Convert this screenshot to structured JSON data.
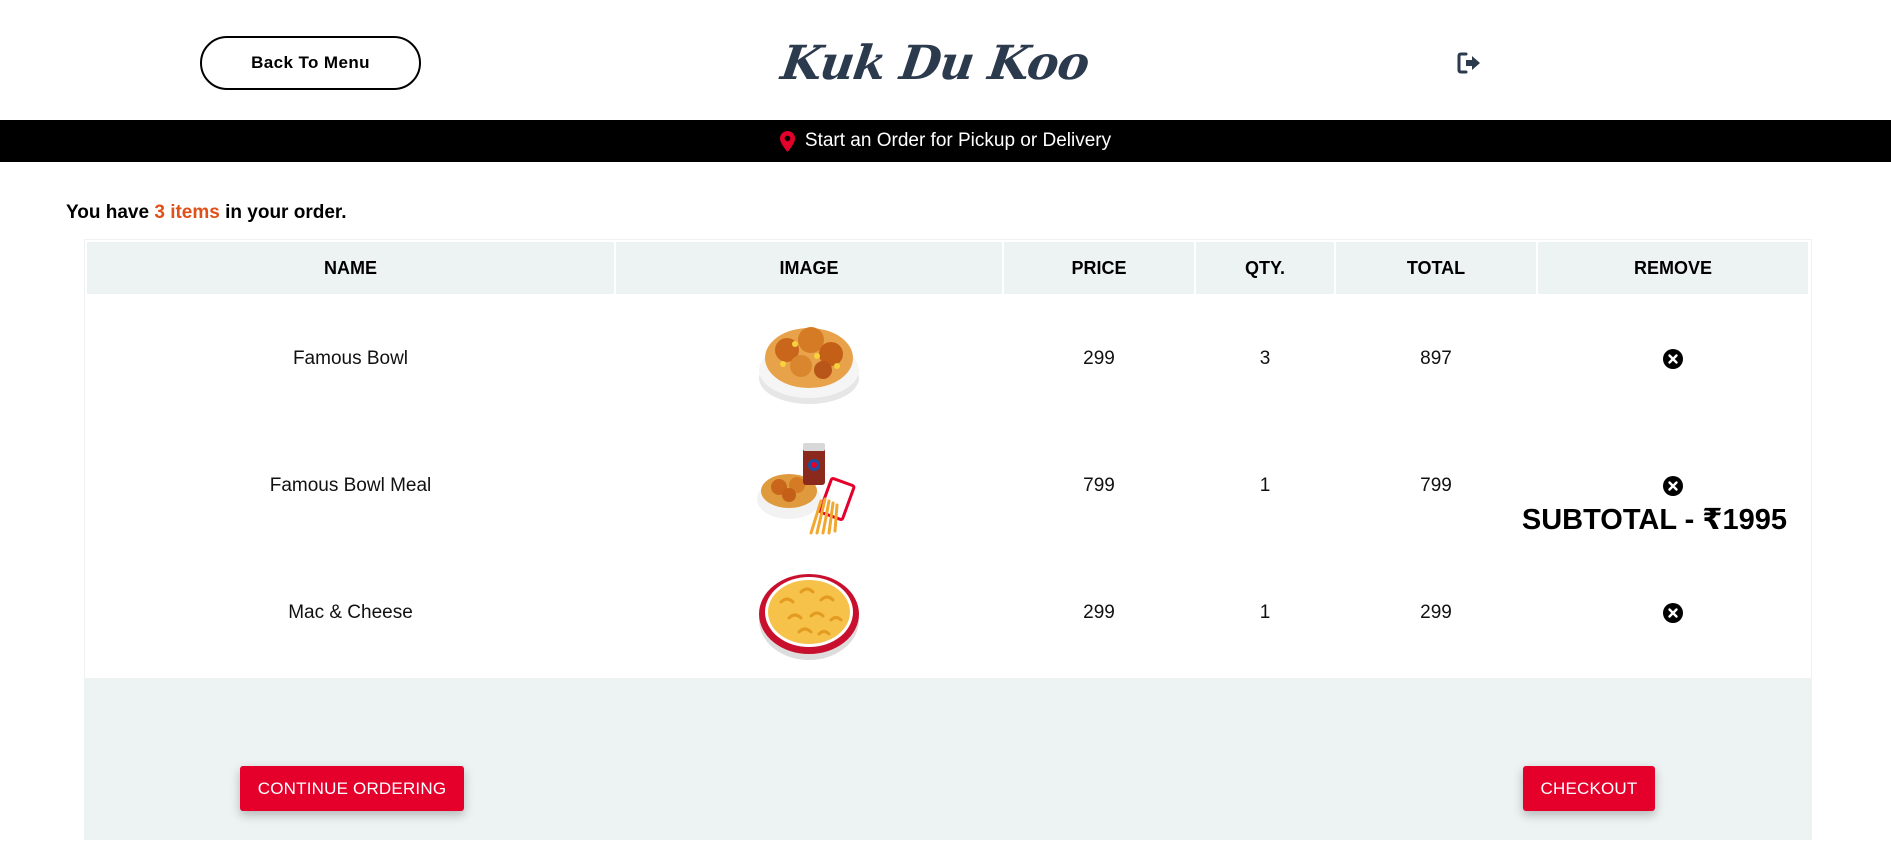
{
  "header": {
    "back_label": "Back To Menu",
    "brand": "Kuk Du Koo",
    "logout_icon": "sign-out-icon"
  },
  "banner": {
    "icon": "map-pin-icon",
    "text": "Start an Order for Pickup or Delivery",
    "pin_color": "#e4002b"
  },
  "summary": {
    "prefix": "You have ",
    "count": "3 items",
    "suffix": " in your order.",
    "count_color": "#e0501a"
  },
  "table": {
    "columns": [
      "NAME",
      "IMAGE",
      "PRICE",
      "QTY.",
      "TOTAL",
      "REMOVE"
    ],
    "rows": [
      {
        "name": "Famous Bowl",
        "image": "famous-bowl-image",
        "price": "299",
        "qty": "3",
        "total": "897"
      },
      {
        "name": "Famous Bowl Meal",
        "image": "famous-bowl-meal-image",
        "price": "799",
        "qty": "1",
        "total": "799"
      },
      {
        "name": "Mac & Cheese",
        "image": "mac-and-cheese-image",
        "price": "299",
        "qty": "1",
        "total": "299"
      }
    ]
  },
  "footer": {
    "subtotal": "SUBTOTAL - ₹1995",
    "continue_label": "CONTINUE ORDERING",
    "checkout_label": "CHECKOUT"
  },
  "colors": {
    "accent": "#e4002b",
    "header_bg": "#edf2f2",
    "brand_color": "#2c3a4d"
  }
}
